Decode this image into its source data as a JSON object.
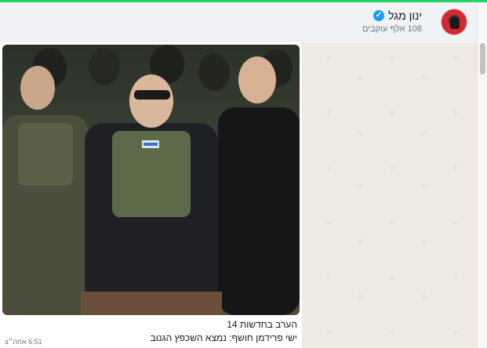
{
  "header": {
    "channel_name": "ינון מגל",
    "followers": "108 אלף עוקבים"
  },
  "message": {
    "caption_line1": "הערב בחדשות 14",
    "caption_line2": "ישי פרידמן חושף: נמצא השכפץ הגנוב",
    "timestamp": "6:51 אחה״צ"
  },
  "colors": {
    "accent": "#25d366",
    "verified": "#1d9bf0",
    "chat_bg": "#efeae2"
  },
  "icons": {
    "verified": "verified-badge-icon",
    "avatar": "channel-avatar"
  }
}
